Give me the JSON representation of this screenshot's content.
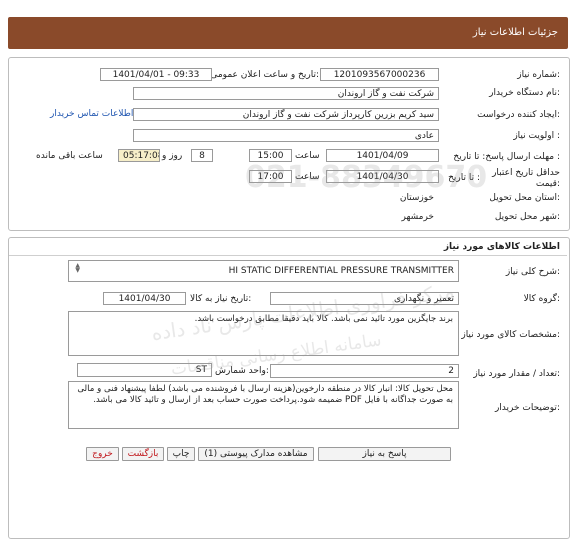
{
  "header": {
    "title": "جزئیات اطلاعات نیاز"
  },
  "fields": {
    "need_number_label": "شماره نیاز:",
    "need_number": "1201093567000236",
    "announce_label": "تاریخ و ساعت اعلان عمومی:",
    "announce_value": "1401/04/01 - 09:33",
    "buyer_org_label": "نام دستگاه خریدار:",
    "buyer_org": "شرکت نفت و گاز اروندان",
    "creator_label": "ایجاد کننده درخواست:",
    "creator": "سید کریم بزرین کارپرداز شرکت نفت و گاز اروندان",
    "buyer_contact_link": "اطلاعات تماس خریدار",
    "priority_label": "اولویت نیاز :",
    "priority": "عادی",
    "reply_deadline_label": "مهلت ارسال پاسخ: تا تاریخ :",
    "reply_date": "1401/04/09",
    "time_label": "ساعت",
    "reply_time": "15:00",
    "days": "8",
    "days_label": "روز و",
    "remaining_time": "05:17:08",
    "remaining_label": "ساعت باقی مانده",
    "validity_label": "حداقل تاریخ اعتبار قیمت:",
    "validity_until_label": "تا تاریخ :",
    "validity_date": "1401/04/30",
    "validity_time": "17:00",
    "province_label": "استان محل تحویل:",
    "province": "خوزستان",
    "city_label": "شهر محل تحویل:",
    "city": "خرمشهر"
  },
  "goods": {
    "section_title": "اطلاعات کالاهای مورد نیاز",
    "summary_label": "شرح کلی نیاز:",
    "summary": "HI STATIC DIFFERENTIAL PRESSURE TRANSMITTER",
    "group_label": "گروه کالا:",
    "group": "تعمیر و نگهداری",
    "need_date_label": "تاریخ نیاز به کالا:",
    "need_date": "1401/04/30",
    "specs_label": "مشخصات کالای مورد نیاز:",
    "specs": "برند جایگزین مورد تائید نمی باشد. کالا باید دقیقا مطابق درخواست باشد.",
    "qty_label": "تعداد / مقدار مورد نیاز:",
    "qty": "2",
    "unit_label": "واحد شمارش:",
    "unit": "ST",
    "buyer_notes_label": "توضیحات خریدار:",
    "buyer_notes": "محل تحویل کالا: انبار کالا در منطقه دارخوین(هزینه ارسال با فروشنده می باشد) لطفا پیشنهاد فنی و مالی به صورت جداگانه با فایل PDF ضمیمه شود.پرداخت صورت حساب بعد از ارسال و تائید کالا می باشد."
  },
  "buttons": {
    "reply": "پاسخ به نیاز",
    "attachments": "مشاهده مدارک پیوستی (1)",
    "print": "چاپ",
    "back": "بازگشت",
    "exit": "خروج"
  },
  "watermark": {
    "line1": "مرکز فراوری اطلاعات پارس ناد داده",
    "line2": "سامانه اطلاع رسانی مناقصات",
    "phone": "021-88349670"
  },
  "colors": {
    "header_bg": "#8a4a2a",
    "link": "#1f55b0",
    "exit": "#c0161b",
    "remaining_bg": "#f6eec8"
  }
}
